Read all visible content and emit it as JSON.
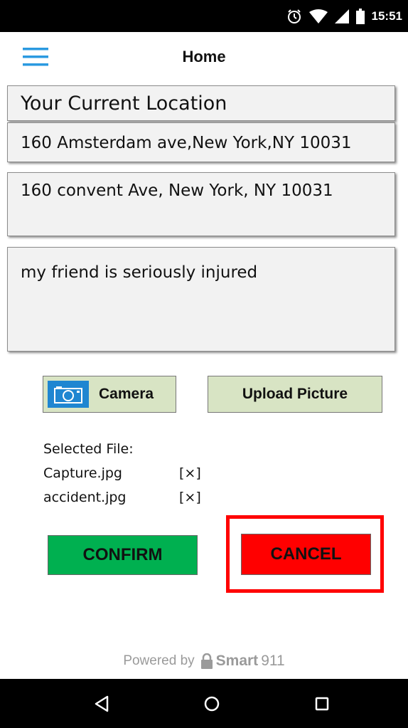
{
  "status_bar": {
    "time": "15:51",
    "icons": [
      "alarm-icon",
      "wifi-icon",
      "signal-icon",
      "battery-icon"
    ]
  },
  "app_bar": {
    "title": "Home",
    "menu_icon": "hamburger-menu-icon"
  },
  "location": {
    "label": "Your Current Location",
    "value": "160 Amsterdam ave,New York,NY 10031"
  },
  "destination": {
    "value": "160 convent Ave, New York, NY 10031"
  },
  "description": {
    "value": "my friend is seriously injured"
  },
  "buttons": {
    "camera_label": "Camera",
    "upload_label": "Upload Picture",
    "confirm_label": "CONFIRM",
    "cancel_label": "CANCEL"
  },
  "files": {
    "label": "Selected File:",
    "items": [
      {
        "name": "Capture.jpg",
        "remove": "[×]"
      },
      {
        "name": "accident.jpg",
        "remove": "[×]"
      }
    ]
  },
  "footer": {
    "powered_by": "Powered by",
    "brand_bold": "Smart",
    "brand_light": "911"
  },
  "colors": {
    "confirm_bg": "#00b050",
    "cancel_bg": "#ff0000",
    "highlight": "#ff0000",
    "secondary_button_bg": "#d8e4c4",
    "accent_blue": "#1f86d1"
  }
}
